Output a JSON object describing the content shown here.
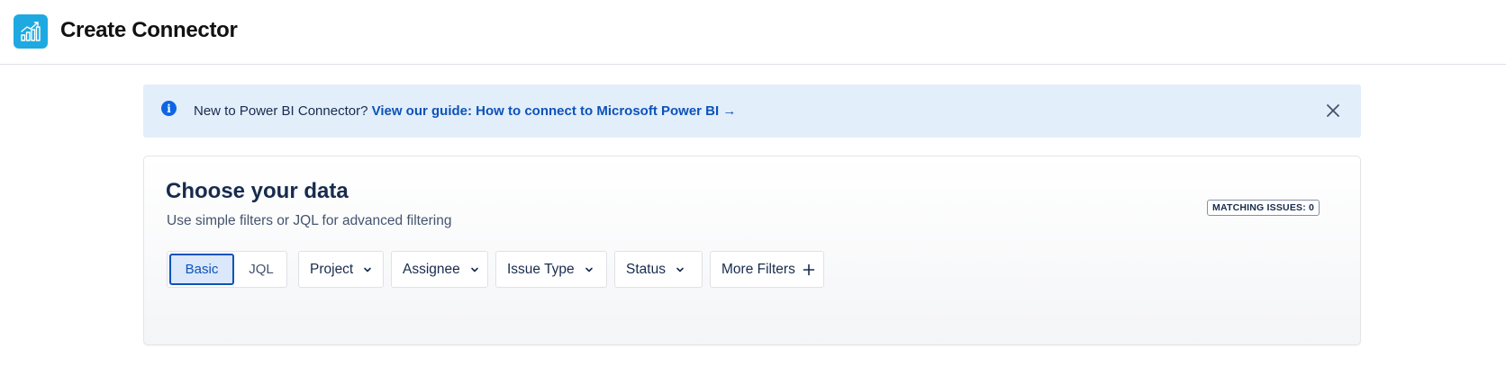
{
  "header": {
    "logo_icon": "bar-chart-growth-icon",
    "title": "Create Connector",
    "accent_color": "#1fa9e1"
  },
  "banner": {
    "icon": "info-icon",
    "text": "New to Power BI Connector? ",
    "link_text": "View our guide: How to connect to Microsoft Power BI →",
    "close_icon": "close-icon",
    "background": "#e3eefb"
  },
  "panel": {
    "title": "Choose your data",
    "subtitle": "Use simple filters or JQL for advanced filtering",
    "matching_issues": "MATCHING ISSUES: 0",
    "mode_toggle": {
      "selected": "Basic",
      "options": [
        "Basic",
        "JQL"
      ]
    },
    "filters": [
      {
        "label": "Project",
        "icon": "chevron-down-icon"
      },
      {
        "label": "Assignee",
        "icon": "chevron-down-icon"
      },
      {
        "label": "Issue Type",
        "icon": "chevron-down-icon"
      },
      {
        "label": "Status",
        "icon": "chevron-down-icon"
      },
      {
        "label": "More Filters",
        "icon": "plus-icon"
      }
    ]
  }
}
